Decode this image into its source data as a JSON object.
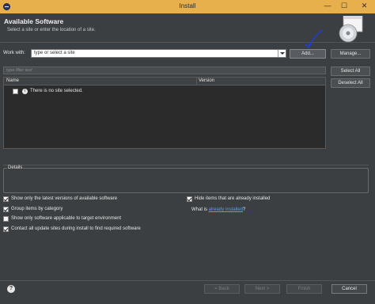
{
  "window": {
    "title": "Install",
    "min_glyph": "—",
    "max_glyph": "☐",
    "close_glyph": "✕"
  },
  "header": {
    "title": "Available Software",
    "subtitle": "Select a site or enter the location of a site."
  },
  "work_with": {
    "label": "Work with:",
    "value": "type or select a site",
    "add_label": "Add...",
    "manage_label": "Manage..."
  },
  "filter": {
    "placeholder": "type filter text"
  },
  "buttons": {
    "select_all": "Select All",
    "deselect_all": "Deselect All"
  },
  "table": {
    "columns": [
      "Name",
      "Version"
    ],
    "rows": [
      {
        "checked": false,
        "icon": "info-icon",
        "text": "There is no site selected."
      }
    ]
  },
  "details": {
    "label": "Details"
  },
  "options": {
    "show_latest": {
      "label": "Show only the latest versions of available software",
      "checked": true
    },
    "group_by_category": {
      "label": "Group items by category",
      "checked": true
    },
    "show_applicable": {
      "label": "Show only software applicable to target environment",
      "checked": false
    },
    "contact_sites": {
      "label": "Contact all update sites during install to find required software",
      "checked": true
    },
    "hide_installed": {
      "label": "Hide items that are already installed",
      "checked": true
    },
    "what_is_prefix": "What is ",
    "what_is_link": "already installed",
    "what_is_suffix": "?"
  },
  "footer": {
    "help_glyph": "?",
    "back_label": "< Back",
    "next_label": "Next >",
    "finish_label": "Finish",
    "cancel_label": "Cancel"
  },
  "colors": {
    "titlebar": "#e8b04c",
    "background": "#3c3f41",
    "table_bg": "#2b2b2b",
    "link": "#589df6",
    "annotation": "#1d3fd8"
  }
}
